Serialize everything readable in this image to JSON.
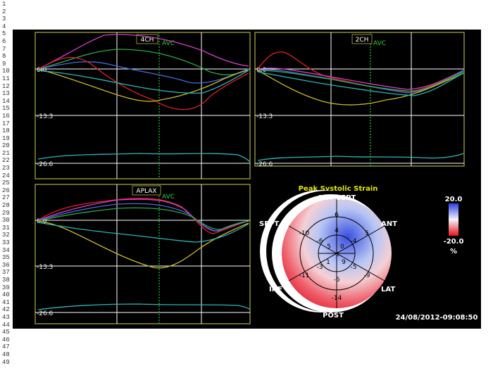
{
  "line_numbers": [
    "1",
    "2",
    "3",
    "4",
    "5",
    "6",
    "7",
    "8",
    "9",
    "10",
    "11",
    "12",
    "13",
    "14",
    "15",
    "16",
    "17",
    "18",
    "19",
    "20",
    "21",
    "22",
    "23",
    "24",
    "25",
    "26",
    "27",
    "28",
    "29",
    "30",
    "31",
    "32",
    "33",
    "34",
    "35",
    "36",
    "37",
    "38",
    "39",
    "40",
    "41",
    "42",
    "43",
    "44",
    "45",
    "46",
    "47",
    "48",
    "49"
  ],
  "panels": [
    {
      "id": "4ch",
      "label": "4CH",
      "avc_label": "AVC",
      "y_labels": [
        "0.0",
        "-13.3",
        "-26.6"
      ]
    },
    {
      "id": "2ch",
      "label": "2CH",
      "avc_label": "AVC",
      "y_labels": [
        "0.0",
        "-13.3",
        "-26.6"
      ]
    },
    {
      "id": "aplax",
      "label": "APLAX",
      "avc_label": "AVC",
      "y_labels": [
        "0.0",
        "-13.3",
        "-26.6"
      ]
    }
  ],
  "bullseye": {
    "title": "Peak Systolic Strain",
    "segment_labels": [
      "ANT SEPT",
      "ANT",
      "LAT",
      "POST",
      "INF",
      "SEPT"
    ],
    "values": [
      "6",
      "5",
      "-9",
      "-14",
      "-11",
      "-10",
      "4",
      "-4",
      "-5",
      "-6",
      "-3",
      "-6",
      "0",
      "9",
      "1",
      "5",
      "-3"
    ]
  },
  "scale": {
    "max": "20.0",
    "min": "-20.0",
    "unit": "%"
  },
  "timestamp": "24/08/2012-09:08:50",
  "colors": {
    "panel_border": "#8c8c3c",
    "avc_line": "#1f9f2f",
    "label_green": "#33cc44",
    "title_yellow": "#e6e600",
    "curve_red": "#e0202a",
    "curve_magenta": "#d040c0",
    "curve_green": "#2fa84a",
    "curve_blue": "#4a6ae0",
    "curve_yellow": "#c8b830",
    "curve_cyan": "#2fb5b5"
  }
}
